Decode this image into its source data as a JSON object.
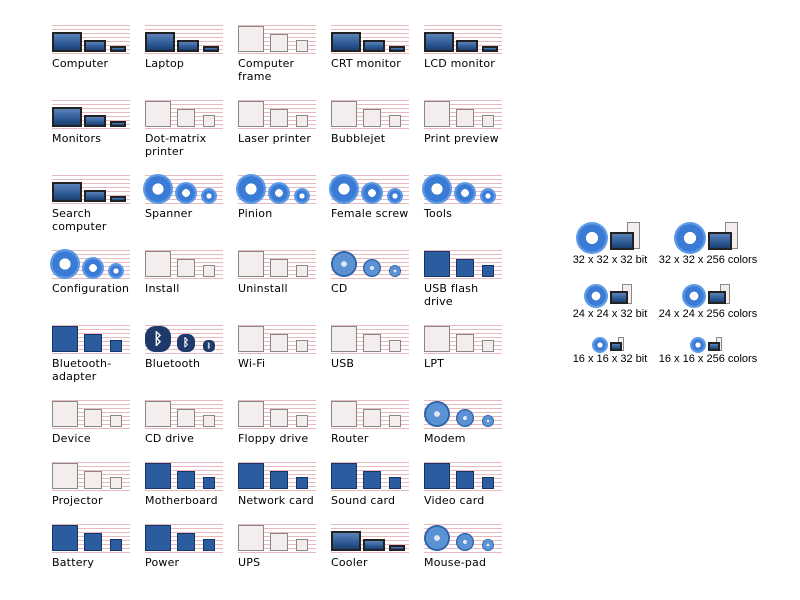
{
  "icon_sets": [
    {
      "label": "Computer",
      "icon": "computer-icon"
    },
    {
      "label": "Laptop",
      "icon": "laptop-icon"
    },
    {
      "label": "Computer\nframe",
      "icon": "computer-frame-icon"
    },
    {
      "label": "CRT monitor",
      "icon": "crt-monitor-icon"
    },
    {
      "label": "LCD monitor",
      "icon": "lcd-monitor-icon"
    },
    {
      "label": "Monitors",
      "icon": "monitors-icon"
    },
    {
      "label": "Dot-matrix\nprinter",
      "icon": "dot-matrix-printer-icon"
    },
    {
      "label": "Laser printer",
      "icon": "laser-printer-icon"
    },
    {
      "label": "Bubblejet",
      "icon": "bubblejet-icon"
    },
    {
      "label": "Print preview",
      "icon": "print-preview-icon"
    },
    {
      "label": "Search\ncomputer",
      "icon": "search-computer-icon"
    },
    {
      "label": "Spanner",
      "icon": "spanner-icon"
    },
    {
      "label": "Pinion",
      "icon": "pinion-icon"
    },
    {
      "label": "Female screw",
      "icon": "female-screw-icon"
    },
    {
      "label": "Tools",
      "icon": "tools-icon"
    },
    {
      "label": "Configuration",
      "icon": "configuration-icon"
    },
    {
      "label": "Install",
      "icon": "install-icon"
    },
    {
      "label": "Uninstall",
      "icon": "uninstall-icon"
    },
    {
      "label": "CD",
      "icon": "cd-icon"
    },
    {
      "label": "USB flash\ndrive",
      "icon": "usb-flash-drive-icon"
    },
    {
      "label": "Bluetooth-\nadapter",
      "icon": "bluetooth-adapter-icon"
    },
    {
      "label": "Bluetooth",
      "icon": "bluetooth-icon"
    },
    {
      "label": "Wi-Fi",
      "icon": "wifi-icon"
    },
    {
      "label": "USB",
      "icon": "usb-icon"
    },
    {
      "label": "LPT",
      "icon": "lpt-icon"
    },
    {
      "label": "Device",
      "icon": "device-icon"
    },
    {
      "label": "CD drive",
      "icon": "cd-drive-icon"
    },
    {
      "label": "Floppy drive",
      "icon": "floppy-drive-icon"
    },
    {
      "label": "Router",
      "icon": "router-icon"
    },
    {
      "label": "Modem",
      "icon": "modem-icon"
    },
    {
      "label": "Projector",
      "icon": "projector-icon"
    },
    {
      "label": "Motherboard",
      "icon": "motherboard-icon"
    },
    {
      "label": "Network card",
      "icon": "network-card-icon"
    },
    {
      "label": "Sound card",
      "icon": "sound-card-icon"
    },
    {
      "label": "Video card",
      "icon": "video-card-icon"
    },
    {
      "label": "Battery",
      "icon": "battery-icon"
    },
    {
      "label": "Power",
      "icon": "power-icon"
    },
    {
      "label": "UPS",
      "icon": "ups-icon"
    },
    {
      "label": "Cooler",
      "icon": "cooler-icon"
    },
    {
      "label": "Mouse-pad",
      "icon": "mouse-pad-icon"
    }
  ],
  "formats": [
    {
      "label": "32 x 32 x 32 bit"
    },
    {
      "label": "32 x 32 x 256 colors"
    },
    {
      "label": "24 x 24 x 32 bit"
    },
    {
      "label": "24 x 24 x 256 colors"
    },
    {
      "label": "16 x 16 x 32 bit"
    },
    {
      "label": "16 x 16 x 256 colors"
    }
  ],
  "colors": {
    "stripe": "#e9b9bd",
    "accent_blue": "#3a7bd5",
    "dark_blue": "#1e3a6a"
  }
}
